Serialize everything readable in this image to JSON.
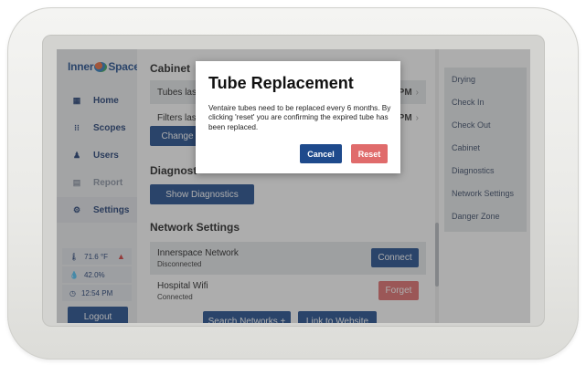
{
  "brand": {
    "logo_left": "Inner",
    "logo_right": "Space"
  },
  "sidebar": {
    "items": [
      {
        "label": "Home",
        "icon": "grid-icon",
        "state": "normal"
      },
      {
        "label": "Scopes",
        "icon": "scopes-icon",
        "state": "normal"
      },
      {
        "label": "Users",
        "icon": "user-icon",
        "state": "normal"
      },
      {
        "label": "Report",
        "icon": "report-icon",
        "state": "disabled"
      },
      {
        "label": "Settings",
        "icon": "gear-icon",
        "state": "active"
      }
    ],
    "status": {
      "temperature": "71.6 °F",
      "humidity": "42.0%",
      "time": "12:54 PM"
    },
    "logout_label": "Logout"
  },
  "main": {
    "cabinet_title": "Cabinet",
    "tubes_label": "Tubes las",
    "tubes_value": "PM",
    "filters_label": "Filters las",
    "filters_value": "PM",
    "change_label": "Change",
    "diagnostics_title": "Diagnost",
    "show_diagnostics_label": "Show Diagnostics",
    "network_title": "Network Settings",
    "networks": [
      {
        "name": "Innerspace Network",
        "status": "Disconnected",
        "action": "Connect"
      },
      {
        "name": "Hospital Wifi",
        "status": "Connected",
        "action": "Forget"
      }
    ],
    "search_networks_label": "Search Networks +",
    "link_website_label": "Link to Website"
  },
  "right_panel": {
    "items": [
      "Drying",
      "Check In",
      "Check Out",
      "Cabinet",
      "Diagnostics",
      "Network Settings",
      "Danger Zone"
    ]
  },
  "modal": {
    "title": "Tube Replacement",
    "body": "Ventaire tubes need to be replaced every 6 months. By clicking 'reset' you are confirming the expired tube has been replaced.",
    "cancel_label": "Cancel",
    "reset_label": "Reset"
  },
  "colors": {
    "primary": "#1e4a8c",
    "danger": "#e06b6b",
    "warning": "#d23b3b"
  }
}
